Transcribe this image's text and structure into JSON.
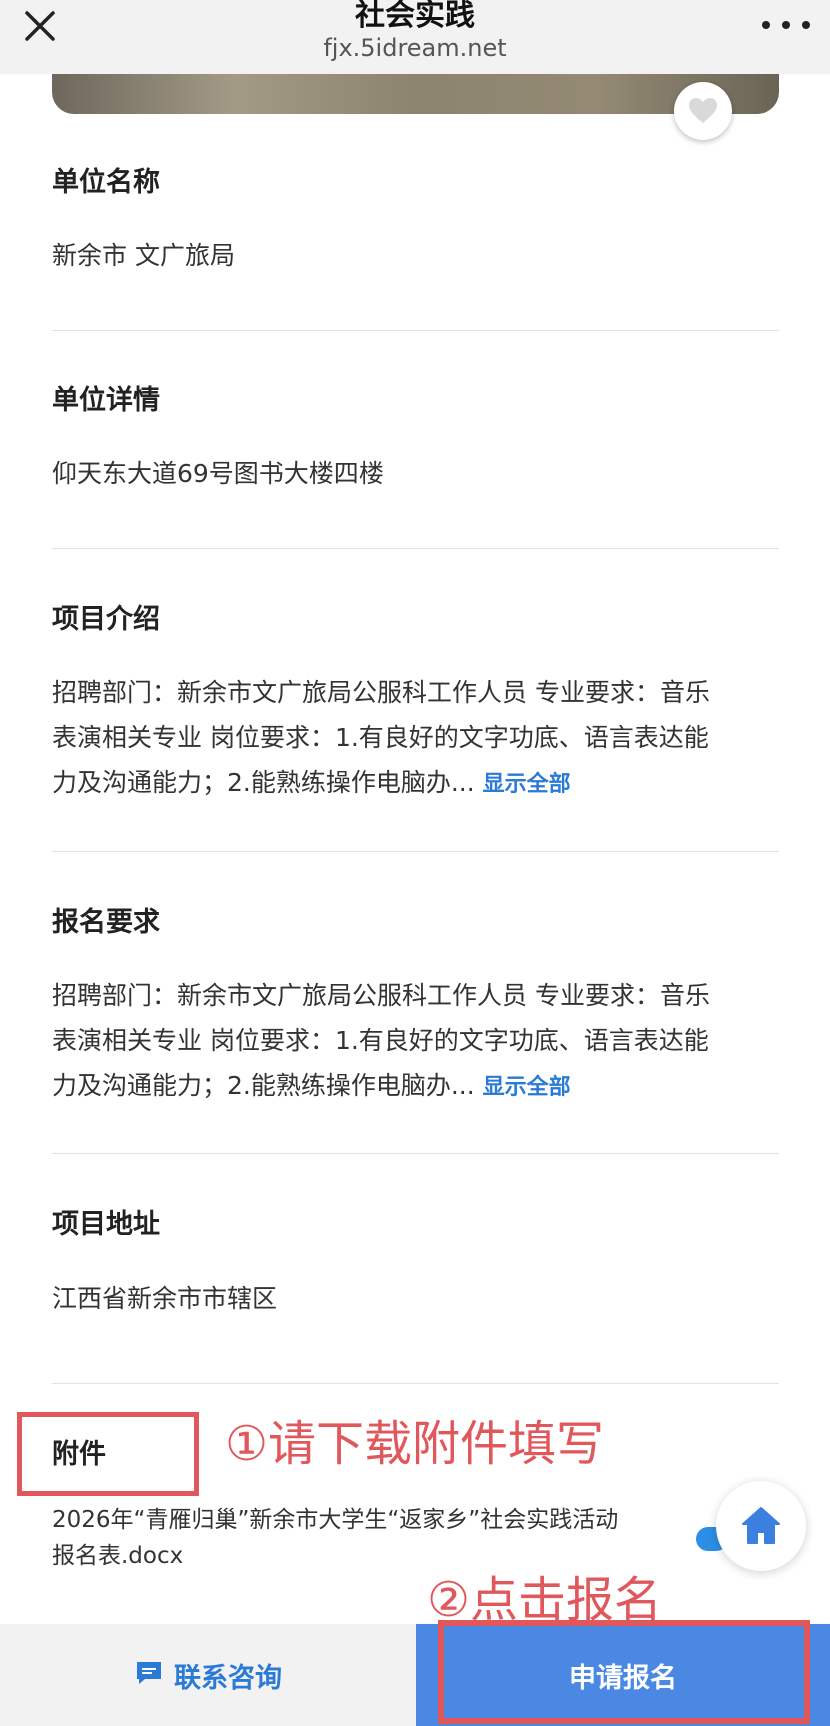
{
  "header": {
    "title": "社会实践",
    "url": "fjx.5idream.net"
  },
  "sections": {
    "unit_name": {
      "label": "单位名称",
      "value": "新余市 文广旅局"
    },
    "unit_detail": {
      "label": "单位详情",
      "value": "仰天东大道69号图书大楼四楼"
    },
    "project_intro": {
      "label": "项目介绍",
      "lines": [
        "招聘部门：新余市文广旅局公服科工作人员 专业要求：音乐",
        "表演相关专业 岗位要求：1.有良好的文字功底、语言表达能",
        "力及沟通能力；2.能熟练操作电脑办..."
      ],
      "more": "显示全部"
    },
    "signup_req": {
      "label": "报名要求",
      "lines": [
        "招聘部门：新余市文广旅局公服科工作人员 专业要求：音乐",
        "表演相关专业 岗位要求：1.有良好的文字功底、语言表达能",
        "力及沟通能力；2.能熟练操作电脑办..."
      ],
      "more": "显示全部"
    },
    "project_address": {
      "label": "项目地址",
      "value": "江西省新余市市辖区"
    },
    "attachment": {
      "label": "附件",
      "line1": "2026年“青雁归巢”新余市大学生“返家乡”社会实践活动",
      "line2": "报名表.docx"
    }
  },
  "annotations": {
    "step1": "①请下载附件填写",
    "step2": "②点击报名"
  },
  "bottom": {
    "consult": "联系咨询",
    "apply": "申请报名"
  },
  "icons": [
    "close-icon",
    "more-icon",
    "heart-icon",
    "home-icon",
    "chat-icon"
  ],
  "colors": {
    "accent": "#2a7ad6",
    "apply_bg": "#4a88e4",
    "annotation": "#e0585c"
  }
}
